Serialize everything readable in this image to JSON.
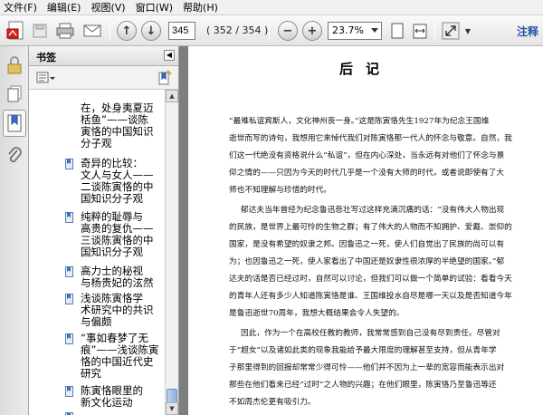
{
  "menu": [
    "文件(F)",
    "编辑(E)",
    "视图(V)",
    "窗口(W)",
    "帮助(H)"
  ],
  "toolbar": {
    "current_page": "345",
    "page_count": "( 352 / 354 )",
    "zoom": "23.7%",
    "annotate_label": "注释"
  },
  "panel": {
    "title": "书签"
  },
  "bookmarks": [
    "在，处身夷夏迈\n栝鱼”——谈陈\n寅恪的中国知识\n分子观",
    "奇异的比较：\n文人与女人——\n二谈陈寅恪的中\n国知识分子观",
    "纯粹的耻辱与\n高贵的复仇——\n三谈陈寅恪的中\n国知识分子观",
    "高力士的秘视\n与杨贵妃的泫然",
    "浅谈陈寅恪学\n术研究中的共识\n与偏颇",
    "“事如春梦了无\n痕”——浅谈陈寅\n恪的中国近代史\n研究",
    "陈寅恪眼里的\n新文化运动",
    "……"
  ],
  "document": {
    "title": "后记",
    "lines": [
      "“最难私谊宾斯人，文化神州丧一身。”这是陈寅恪先生1927年为纪念王国维",
      "逝世而写的诗句，我想用它来悼代我们对陈寅恪那一代人的怀念与敬意。自然，我",
      "们这一代绝没有资格说什么“私谊”，但在内心深处，当永远有对他们了怀念与景",
      "仰之情的——只因为今天的时代几乎是一个没有大师的时代，或者说即使有了大",
      "师也不知理解与珍惜的时代。",
      "郁达夫当年曾经为纪念鲁迅悲壮写过这样充满沉痛的话：“没有伟大人物出现",
      "的民族，是世界上最可怜的生物之群；有了伟大的人物而不知拥护、爱戴、崇仰的",
      "国家，是没有希望的奴隶之邦。因鲁迅之一死，使人们自觉出了民族的尚可以有",
      "为；也因鲁迅之一死，使人家看出了中国还是奴隶性很浓厚的半绝望的国家。”郁",
      "达夫的话是否已经过时，自然可以讨论，但我们可以做一个简单的试验：看看今天",
      "的青年人还有多少人知道陈寅恪是谁、王国维投水自尽是哪一天以及是否知道今年",
      "是鲁迅逝世70周年，我想大概结果会令人失望的。",
      "因此，作为一个在高校任教的教师，我常常感到自己没有尽到责任。尽管对",
      "于“超女”以及诸如此类的现象我能给予最大限度的理解甚至支持，但从青年学",
      "子那里得到的回报却常常少得可怜——他们并不因为上一辈的宽容而能表示出对",
      "那些在他们看来已经“过时”之人物的兴趣；在他们眼里，陈寅恪乃至鲁迅等还",
      "不如周杰伦更有吸引力。"
    ]
  }
}
